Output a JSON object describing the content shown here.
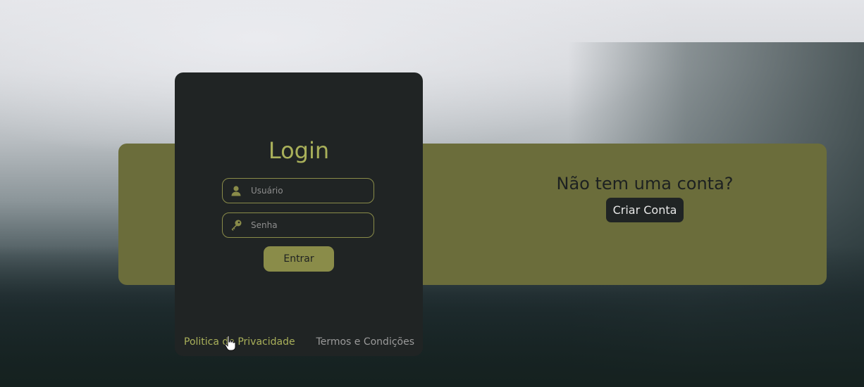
{
  "login": {
    "title": "Login",
    "username_placeholder": "Usuário",
    "password_placeholder": "Senha",
    "submit_label": "Entrar"
  },
  "footer": {
    "privacy_label": "Politica de Privacidade",
    "terms_label": "Termos e Condições"
  },
  "promo": {
    "text": "Não tem uma conta?",
    "create_label": "Criar Conta"
  },
  "icons": {
    "user": "user-icon",
    "key": "key-icon",
    "cursor": "hand-pointer-icon"
  },
  "colors": {
    "accent": "#a9b05a",
    "banner": "#6b6d3b",
    "card": "#202424"
  }
}
